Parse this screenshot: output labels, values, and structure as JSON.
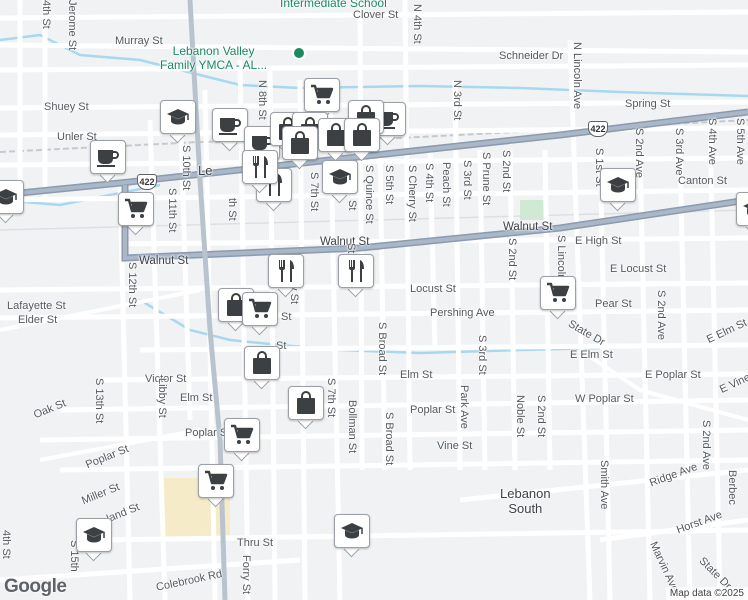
{
  "map": {
    "streets": {
      "s_4th_st_top": "4th St",
      "jerome_st": "Jerome St",
      "clover_st": "Clover St",
      "n_4th_st": "N 4th St",
      "murray_st": "Murray St",
      "schneider_dr": "Schneider Dr",
      "n_lincoln_ave": "N Lincoln Ave",
      "n_8th_st": "N 8th St",
      "n_3rd_st": "N 3rd St",
      "spring_st": "Spring St",
      "shuey_st": "Shuey St",
      "unler_st": "Unler St",
      "s_11th_st": "S 11th St",
      "s_10th_st": "S 10th St",
      "s_9th_st": "S 9th St",
      "s_7th_st": "S 7th St",
      "s_quince_st": "S Quince St",
      "s_5th_st": "S 5th St",
      "s_cherry_st": "S Cherry St",
      "s_4th_st": "S 4th St",
      "peach_st": "Peach St",
      "s_3rd_st": "S 3rd St",
      "s_prune_st": "S Prune St",
      "s_2nd_st": "S 2nd St",
      "s_1st_st": "S 1st St",
      "s_2nd_ave": "S 2nd Ave",
      "s_3rd_ave": "S 3rd Ave",
      "s_4th_ave": "S 4th Ave",
      "s_5th_ave": "S 5th Ave",
      "canton_st": "Canton St",
      "walnut_st_left": "Walnut St",
      "walnut_st_mid": "Walnut St",
      "walnut_st_right": "Walnut St",
      "e_high_st": "E High St",
      "s_12th_st": "S 12th St",
      "lafayette_st": "Lafayette St",
      "elder_st": "Elder St",
      "locust_st": "Locust St",
      "e_locust_st": "E Locust St",
      "pear_st": "Pear St",
      "pershing_ave": "Pershing Ave",
      "s_2nd_st_mid": "S 2nd St",
      "s_lincoln_ave": "S Lincoln Ave",
      "state_dr": "State Dr",
      "e_elm_st_right": "E Elm St",
      "e_elm_st": "E Elm St",
      "s_2nd_ave_mid": "S 2nd Ave",
      "victor_st": "Victor St",
      "s_13th_st": "S 13th St",
      "libby_st": "Libby St",
      "elm_st_left": "Elm St",
      "s_broad_st": "S Broad St",
      "s_3rd_st_mid": "S 3rd St",
      "elm_st": "Elm St",
      "e_poplar_st": "E Poplar St",
      "e_vine_st": "E Vine St",
      "oak_st": "Oak St",
      "s_7th_st_low": "S 7th St",
      "bollman_st": "Bollman St",
      "park_ave": "Park Ave",
      "poplar_st_mid": "Poplar St",
      "w_poplar_st": "W Poplar St",
      "noble_st": "Noble St",
      "s_2nd_st_low": "S 2nd St",
      "poplar_st_left": "Poplar St",
      "poplar_st_left2": "Poplar St",
      "s_broad_st_low": "S Broad St",
      "vine_st": "Vine St",
      "s_2nd_ave_low": "S 2nd Ave",
      "berbec": "Berbec",
      "miller_st": "Miller St",
      "smith_ave": "Smith Ave",
      "ridge_ave": "Ridge Ave",
      "s_15th": "S 15th",
      "land_st": "land St",
      "thru_st": "Thru St",
      "horst_ave": "Horst Ave",
      "state_dr_low": "State Dr",
      "marvin_ave": "Marvin Ave",
      "colebrook_rd": "Colebrook Rd",
      "forry_st": "Forry St",
      "s_4th_low_left": "4th St",
      "s_8th_partial": "S 8th St",
      "s_11th_partial": "th St",
      "ty_st": "ty St",
      "st_frag": "St",
      "st_frag2": "St",
      "st_frag3": "St",
      "st_frag4": "St",
      "lebanon_frag": "Le"
    },
    "places": {
      "school_top": "Intermediate School",
      "ymca": "Lebanon Valley\nFamily YMCA - AL...",
      "lebanon_south": "Lebanon\nSouth"
    },
    "route_shields": {
      "shield_1": "422",
      "shield_2": "422"
    },
    "colors": {
      "background": "#f1f2f4",
      "road": "#ffffff",
      "road_edge": "#dadce0",
      "highway": "#8a9bb0",
      "water": "#a7d8f0",
      "rail": "#c6cace",
      "park": "#cfe9d2",
      "poi_green": "#1d8a63",
      "pin_icon": "#3c4043"
    },
    "pins": [
      {
        "icon": "shopping-cart-icon"
      },
      {
        "icon": "coffee-icon"
      },
      {
        "icon": "graduation-cap-icon"
      },
      {
        "icon": "coffee-icon"
      },
      {
        "icon": "coffee-icon"
      },
      {
        "icon": "shopping-bag-icon"
      },
      {
        "icon": "coffee-icon"
      },
      {
        "icon": "shopping-bag-icon"
      },
      {
        "icon": "shopping-bag-icon"
      },
      {
        "icon": "shopping-bag-icon"
      },
      {
        "icon": "shopping-bag-icon"
      },
      {
        "icon": "shopping-bag-icon"
      },
      {
        "icon": "restaurant-icon"
      },
      {
        "icon": "restaurant-icon"
      },
      {
        "icon": "graduation-cap-icon"
      },
      {
        "icon": "graduation-cap-icon"
      },
      {
        "icon": "graduation-cap-icon"
      },
      {
        "icon": "shopping-cart-icon"
      },
      {
        "icon": "graduation-cap-icon"
      },
      {
        "icon": "restaurant-icon"
      },
      {
        "icon": "restaurant-icon"
      },
      {
        "icon": "shopping-cart-icon"
      },
      {
        "icon": "shopping-bag-icon"
      },
      {
        "icon": "shopping-cart-icon"
      },
      {
        "icon": "shopping-bag-icon"
      },
      {
        "icon": "shopping-bag-icon"
      },
      {
        "icon": "shopping-cart-icon"
      },
      {
        "icon": "shopping-cart-icon"
      },
      {
        "icon": "graduation-cap-icon"
      },
      {
        "icon": "graduation-cap-icon"
      }
    ],
    "attribution": "Map data ©2025",
    "logo": "Google"
  }
}
